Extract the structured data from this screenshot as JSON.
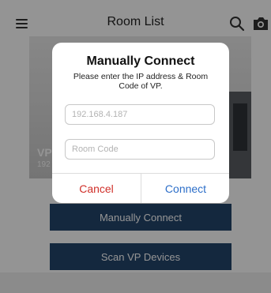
{
  "header": {
    "title": "Room List",
    "menu_icon": "hamburger-menu-icon",
    "search_icon": "search-icon",
    "camera_icon": "camera-icon"
  },
  "room_card": {
    "name": "VP",
    "ip": "192"
  },
  "actions": {
    "manual_connect_label": "Manually Connect",
    "scan_devices_label": "Scan VP Devices"
  },
  "dialog": {
    "title": "Manually Connect",
    "message": "Please enter the IP address & Room Code of VP.",
    "ip_input": {
      "placeholder": "192.168.4.187",
      "value": ""
    },
    "room_code_input": {
      "placeholder": "Room Code",
      "value": ""
    },
    "cancel_label": "Cancel",
    "connect_label": "Connect"
  },
  "colors": {
    "action_button_bg": "#24466c",
    "cancel_text": "#d0302a",
    "connect_text": "#2d6fc9"
  }
}
